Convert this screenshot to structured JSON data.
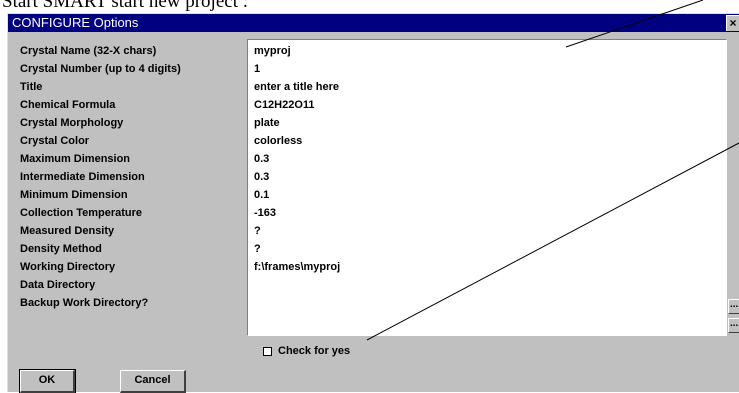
{
  "caption": "Start SMART start new project :",
  "window": {
    "title": "CONFIGURE Options",
    "close_glyph": "×",
    "close_icon": "close-icon"
  },
  "fields": [
    {
      "label": "Crystal Name  (32-X chars)",
      "value": "myproj"
    },
    {
      "label": "Crystal Number (up to 4 digits)",
      "value": "1"
    },
    {
      "label": "Title",
      "value": "enter a title here"
    },
    {
      "label": "Chemical Formula",
      "value": "C12H22O11"
    },
    {
      "label": "Crystal Morphology",
      "value": "plate"
    },
    {
      "label": "Crystal Color",
      "value": "colorless"
    },
    {
      "label": "Maximum Dimension",
      "value": "0.3"
    },
    {
      "label": "Intermediate Dimension",
      "value": "0.3"
    },
    {
      "label": "Minimum Dimension",
      "value": "0.1"
    },
    {
      "label": "Collection Temperature",
      "value": "-163"
    },
    {
      "label": "Measured Density",
      "value": "?"
    },
    {
      "label": "Density Method",
      "value": "?"
    },
    {
      "label": "Working Directory",
      "value": "f:\\frames\\myproj"
    },
    {
      "label": "Data Directory",
      "value": ""
    },
    {
      "label": "Backup Work Directory?",
      "value": ""
    }
  ],
  "browse_label": "...",
  "checkbox": {
    "label": "Check for yes",
    "checked": false
  },
  "buttons": {
    "ok": "OK",
    "cancel": "Cancel"
  },
  "colors": {
    "titlebar": "#000080",
    "dialog": "#c0c0c0",
    "field": "#ffffff"
  }
}
